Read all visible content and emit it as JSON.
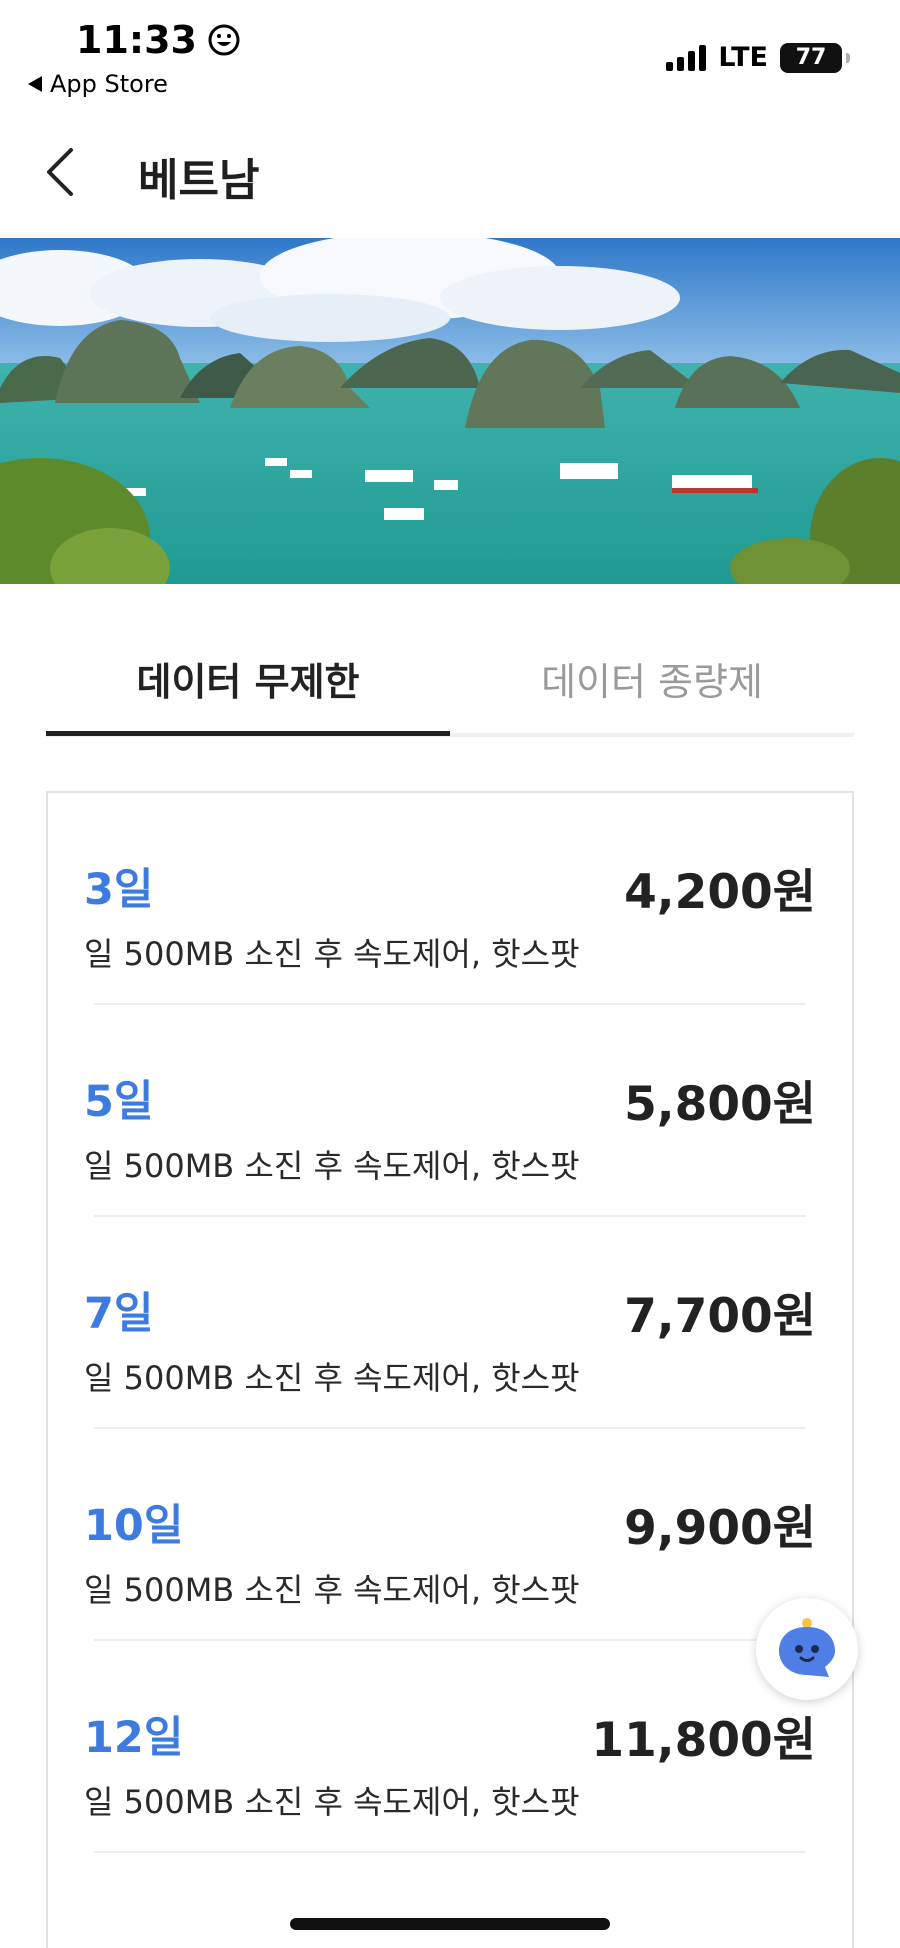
{
  "status_bar": {
    "time": "11:33",
    "back_app": "App Store",
    "network": "LTE",
    "battery": "77"
  },
  "header": {
    "title": "베트남"
  },
  "tabs": [
    {
      "label": "데이터 무제한",
      "active": true
    },
    {
      "label": "데이터 종량제",
      "active": false
    }
  ],
  "plans": [
    {
      "duration": "3일",
      "price": "4,200원",
      "description": "일 500MB 소진 후 속도제어, 핫스팟"
    },
    {
      "duration": "5일",
      "price": "5,800원",
      "description": "일 500MB 소진 후 속도제어, 핫스팟"
    },
    {
      "duration": "7일",
      "price": "7,700원",
      "description": "일 500MB 소진 후 속도제어, 핫스팟"
    },
    {
      "duration": "10일",
      "price": "9,900원",
      "description": "일 500MB 소진 후 속도제어, 핫스팟"
    },
    {
      "duration": "12일",
      "price": "11,800원",
      "description": "일 500MB 소진 후 속도제어, 핫스팟"
    }
  ],
  "colors": {
    "accent": "#3d7be0",
    "text": "#222222",
    "inactive_tab": "#9a9a9a",
    "fab": "#4f7fe6"
  },
  "icons": {
    "back": "chevron-left-icon",
    "chat": "chatbot-icon",
    "status_emoji": "smiley-icon"
  }
}
